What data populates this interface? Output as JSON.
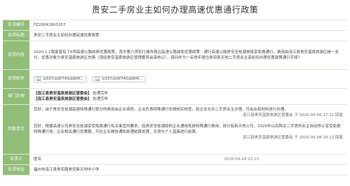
{
  "title": "贵安二手房业主如何办理高速优惠通行政策",
  "labels": {
    "code": "诉求编号",
    "subject": "诉求标题",
    "content": "诉求内容",
    "attachment": "诉求附件",
    "dept": "部门办理",
    "reply": "回复意见",
    "person": "诉求人",
    "address": "诉求地址"
  },
  "code": "FZ20042803357",
  "subject": "贵安二手房业主如何办理高速优惠政策",
  "content": "2020.1.1我家曾有了6项高速公路收费优惠政策，其中第六项实行城市周边高速公路减免优惠政策：通行高速公路贵安至桂湖旅段享免费通行，费用由连江县贵安温泉旅游区统一支付，优惠对象为贵安温泉旅游区车辆（须经贵安温泉旅游区管理委员会审核认），请问作为一名常年居住贵安新天地二手房业主该如何办理优惠政策通行手续？",
  "attachments": [
    "b337cb9f745dd84f...",
    "b337cb9f745dd84f..."
  ],
  "dept_items": [
    {
      "name": "【连江县贵安温泉旅游区管委会】",
      "status": "处理完毕"
    },
    {
      "name": "【连江县贵安温泉旅游区管委会】",
      "status": "处理完毕"
    }
  ],
  "replies": [
    {
      "text": "您好，由于贵安至桂湖高速特殊通行部分的费用由企业承担，企业负责特殊通行车辆核实核查，若企业允许二手房业主办理，可由业权材料进行办理。",
      "org": "连江县贵安温泉旅游区管委会",
      "time": "于 2020-05-06 17:11 回复"
    },
    {
      "text": "您好，根据高速公司贵安至桂湖享受免费通行有关事宜的要求，因贵安至桂湖段的企业通用免费特殊通行费用，部分有新天地公司，2020年以后购买二手房的业主自动停止享受免费特殊通行地。企业相关通行优惠额，可在企业微信通知处理结算处理，无须与个人直接进行结算。",
      "org": "连江县贵安温泉旅游区管委会",
      "time": "于 2020-05-08 18:12 回复"
    }
  ],
  "person": "匿名",
  "submit_time": "2020-04-28 22:13",
  "address": "福州市连江县贵安路贵安新天地中小学"
}
